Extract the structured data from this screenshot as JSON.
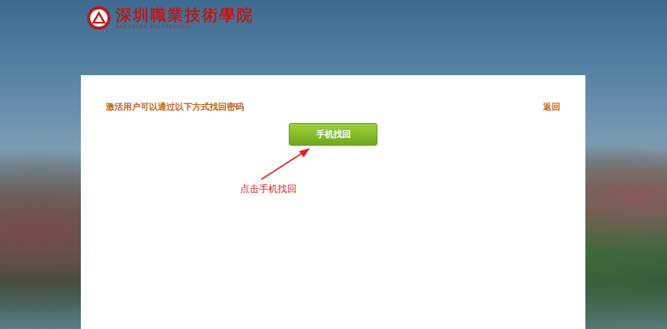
{
  "header": {
    "logo_text": "深圳職業技術學院",
    "logo_subtext": "SHENZHEN POLYTECHNIC"
  },
  "panel": {
    "title": "激活用户可以通过以下方式找回密码",
    "back_link": "返回",
    "buttons": [
      "手机找回"
    ]
  },
  "annotation": {
    "text": "点击手机找回"
  }
}
